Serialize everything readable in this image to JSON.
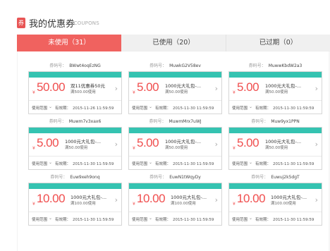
{
  "header": {
    "icon": "coupon-icon",
    "icon_glyph": "券",
    "title": "我的优惠券",
    "subtitle": "/COUPONS"
  },
  "tabs": [
    {
      "label": "未使用（31）",
      "active": true
    },
    {
      "label": "已使用（20）",
      "active": false
    },
    {
      "label": "已过期（0）",
      "active": false
    }
  ],
  "colors": {
    "accent_red": "#f0625f",
    "wave_teal": "#35c3b1",
    "price_red": "#f04e4e"
  },
  "coupon_labels": {
    "code": "券码号：",
    "scope": "使用范围",
    "validity": "有效期：",
    "yen": "¥",
    "chevron": "›",
    "dropdown": "⌄"
  },
  "coupons": [
    {
      "code": "BWwt4oqEzNG",
      "amount": "50.00",
      "desc": "双11优惠券50元",
      "cond": "满500.00使用",
      "expiry": "2015-11-26 11:59:59"
    },
    {
      "code": "MuwkG2V58ev",
      "amount": "5.00",
      "desc": "1000元大礼包-...",
      "cond": "满50.00使用",
      "expiry": "2015-11-30 11:59:59"
    },
    {
      "code": "MuwwKbdW2a3",
      "amount": "5.00",
      "desc": "1000元大礼包-...",
      "cond": "满50.00使用",
      "expiry": "2015-11-30 11:59:59"
    },
    {
      "code": "Muwm7v3xax6",
      "amount": "5.00",
      "desc": "1000元大礼包-...",
      "cond": "满50.00使用",
      "expiry": "2015-11-30 11:59:59"
    },
    {
      "code": "MuwmMrx7uWJ",
      "amount": "5.00",
      "desc": "1000元大礼包-...",
      "cond": "满50.00使用",
      "expiry": "2015-11-30 11:59:59"
    },
    {
      "code": "Muw9yx1PPN",
      "amount": "5.00",
      "desc": "1000元大礼包-...",
      "cond": "满50.00使用",
      "expiry": "2015-11-30 11:59:59"
    },
    {
      "code": "Euw9xeh9onq",
      "amount": "10.00",
      "desc": "1000元大礼包-...",
      "cond": "满100.00使用",
      "expiry": "2015-11-30 11:59:59"
    },
    {
      "code": "EuwN1tWqyDy",
      "amount": "10.00",
      "desc": "1000元大礼包-...",
      "cond": "满100.00使用",
      "expiry": "2015-11-30 11:59:59"
    },
    {
      "code": "Euwuj2k5dgT",
      "amount": "10.00",
      "desc": "1000元大礼包-...",
      "cond": "满100.00使用",
      "expiry": "2015-11-30 11:59:59"
    }
  ]
}
